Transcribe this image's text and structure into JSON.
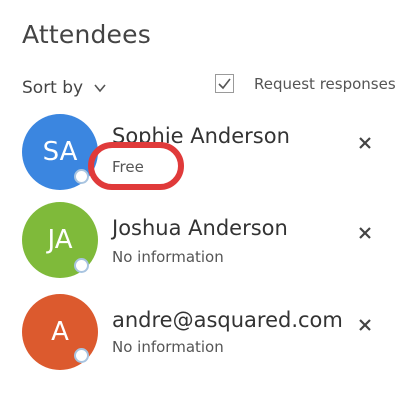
{
  "title": "Attendees",
  "sort": {
    "label": "Sort by"
  },
  "request_responses": {
    "label": "Request responses",
    "checked": true
  },
  "attendees": [
    {
      "initials": "SA",
      "name": "Sophie Anderson",
      "status": "Free",
      "avatar_color": "#3b86e0"
    },
    {
      "initials": "JA",
      "name": "Joshua Anderson",
      "status": "No information",
      "avatar_color": "#7fba3a"
    },
    {
      "initials": "A",
      "name": "andre@asquared.com",
      "status": "No information",
      "avatar_color": "#dc5a2e"
    }
  ],
  "colors": {
    "highlight": "#e03a3a"
  }
}
